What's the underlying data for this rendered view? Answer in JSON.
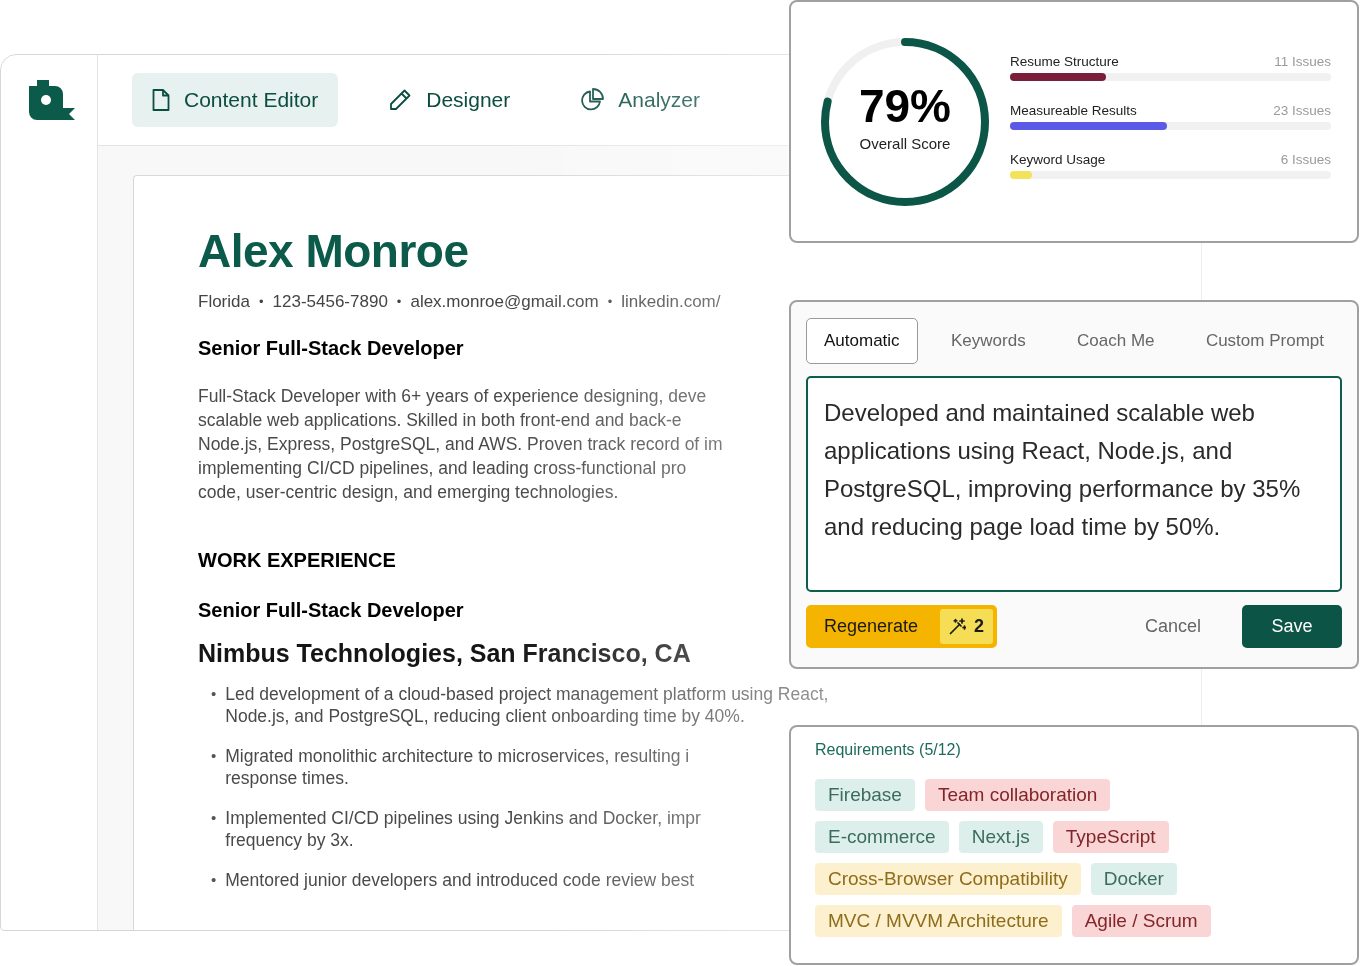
{
  "app": {
    "tabs": [
      {
        "label": "Content Editor",
        "selected": true
      },
      {
        "label": "Designer",
        "selected": false
      },
      {
        "label": "Analyzer",
        "selected": false
      }
    ]
  },
  "resume": {
    "name": "Alex Monroe",
    "contact": [
      {
        "kind": "text",
        "text": "Florida"
      },
      {
        "kind": "separator",
        "text": "•"
      },
      {
        "kind": "text",
        "text": "123-5456-7890"
      },
      {
        "kind": "separator",
        "text": "•"
      },
      {
        "kind": "text",
        "text": "alex.monroe@gmail.com"
      },
      {
        "kind": "separator",
        "text": "•"
      },
      {
        "kind": "text",
        "text": "linkedin.com/"
      }
    ],
    "headline": "Senior Full-Stack Developer",
    "summary_lines": [
      "Full-Stack Developer with 6+ years of experience designing, deve",
      "scalable web applications. Skilled in both front-end and back-e",
      "Node.js, Express, PostgreSQL, and AWS. Proven track record of im",
      "implementing CI/CD pipelines, and leading cross-functional pro",
      "code, user-centric design, and emerging technologies."
    ],
    "section_title": "WORK EXPERIENCE",
    "job": {
      "title": "Senior Full-Stack Developer",
      "company": "Nimbus Technologies, San Francisco, CA",
      "bullets": [
        {
          "marker": "•",
          "lines": [
            "Led development of a cloud-based project management platform using React,",
            "Node.js, and PostgreSQL, reducing client onboarding time by 40%."
          ]
        },
        {
          "marker": "•",
          "lines": [
            "Migrated monolithic architecture to microservices, resulting i",
            "response times."
          ]
        },
        {
          "marker": "•",
          "lines": [
            "Implemented CI/CD pipelines using Jenkins and Docker, impr",
            "frequency by 3x."
          ]
        },
        {
          "marker": "•",
          "lines": [
            "Mentored junior developers and introduced code review best"
          ]
        }
      ]
    }
  },
  "score_card": {
    "score": {
      "value": "79%",
      "label": "Overall Score",
      "level": 0.79
    },
    "issues": [
      {
        "label": "Resume Structure",
        "count": "11 Issues",
        "level": 0.3,
        "color": "#7a1e3c"
      },
      {
        "label": "Measureable Results",
        "count": "23 Issues",
        "level": 0.49,
        "color": "#5a5ae6"
      },
      {
        "label": "Keyword Usage",
        "count": "6 Issues",
        "level": 0.07,
        "color": "#f2e35a"
      }
    ]
  },
  "editor": {
    "tabs": [
      {
        "label": "Automatic",
        "selected": true
      },
      {
        "label": "Keywords",
        "selected": false
      },
      {
        "label": "Coach Me",
        "selected": false
      },
      {
        "label": "Custom Prompt",
        "selected": false
      }
    ],
    "text": "Developed and maintained scalable web applications using React, Node.js, and PostgreSQL, improving performance by 35% and reducing page load time by 50%.",
    "regenerate": {
      "label": "Regenerate",
      "count": "2"
    },
    "cancel": "Cancel",
    "save": "Save"
  },
  "requirements": {
    "title": "Requirements (5/12)",
    "tag_rows": [
      [
        {
          "label": "Firebase",
          "color": "#dcefea"
        },
        {
          "label": "Team collaboration",
          "color": "#f9d5d6"
        }
      ],
      [
        {
          "label": "E-commerce",
          "color": "#dcefea"
        },
        {
          "label": "Next.js",
          "color": "#dcefea"
        },
        {
          "label": "TypeScript",
          "color": "#f9d5d6"
        }
      ],
      [
        {
          "label": "Cross-Browser Compatibility",
          "color": "#fdf0cf"
        },
        {
          "label": "Docker",
          "color": "#dcefea"
        }
      ],
      [
        {
          "label": "MVC / MVVM Architecture",
          "color": "#fdf0cf"
        },
        {
          "label": "Agile / Scrum",
          "color": "#f9d5d6"
        }
      ]
    ]
  }
}
